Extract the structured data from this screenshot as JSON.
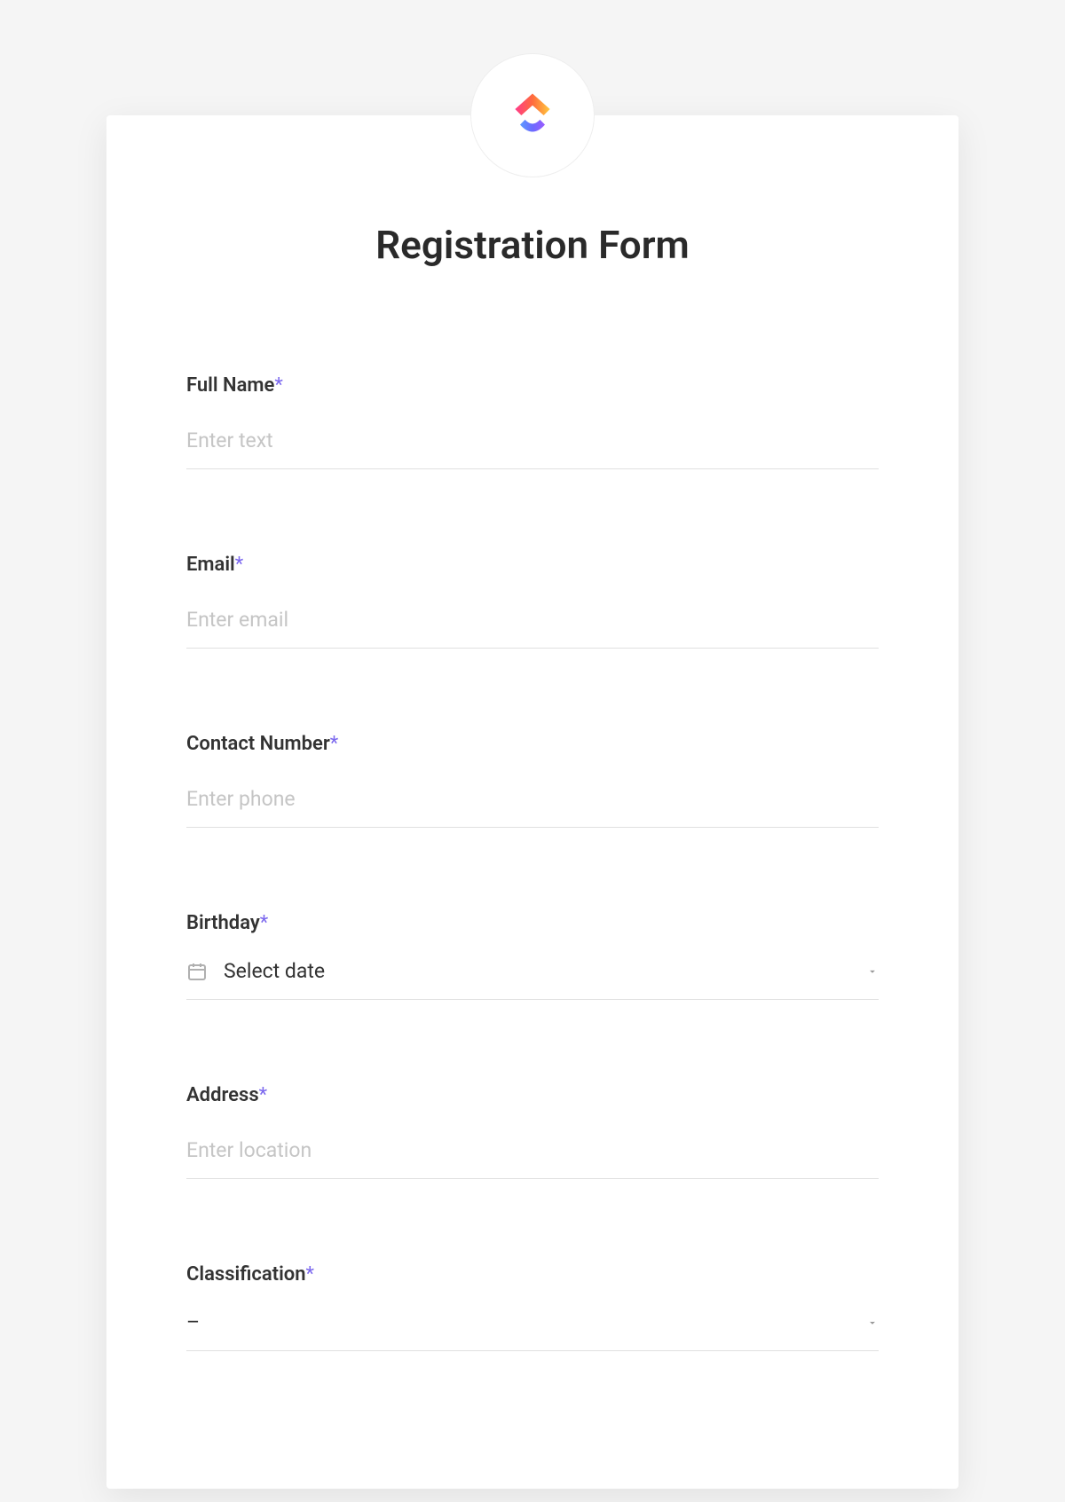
{
  "form": {
    "title": "Registration Form",
    "fields": {
      "fullName": {
        "label": "Full Name",
        "required": true,
        "placeholder": "Enter text",
        "value": ""
      },
      "email": {
        "label": "Email",
        "required": true,
        "placeholder": "Enter email",
        "value": ""
      },
      "contactNumber": {
        "label": "Contact Number",
        "required": true,
        "placeholder": "Enter phone",
        "value": ""
      },
      "birthday": {
        "label": "Birthday",
        "required": true,
        "placeholder": "Select date",
        "value": ""
      },
      "address": {
        "label": "Address",
        "required": true,
        "placeholder": "Enter location",
        "value": ""
      },
      "classification": {
        "label": "Classification",
        "required": true,
        "placeholder": "–",
        "value": ""
      }
    },
    "requiredMarker": "*"
  }
}
